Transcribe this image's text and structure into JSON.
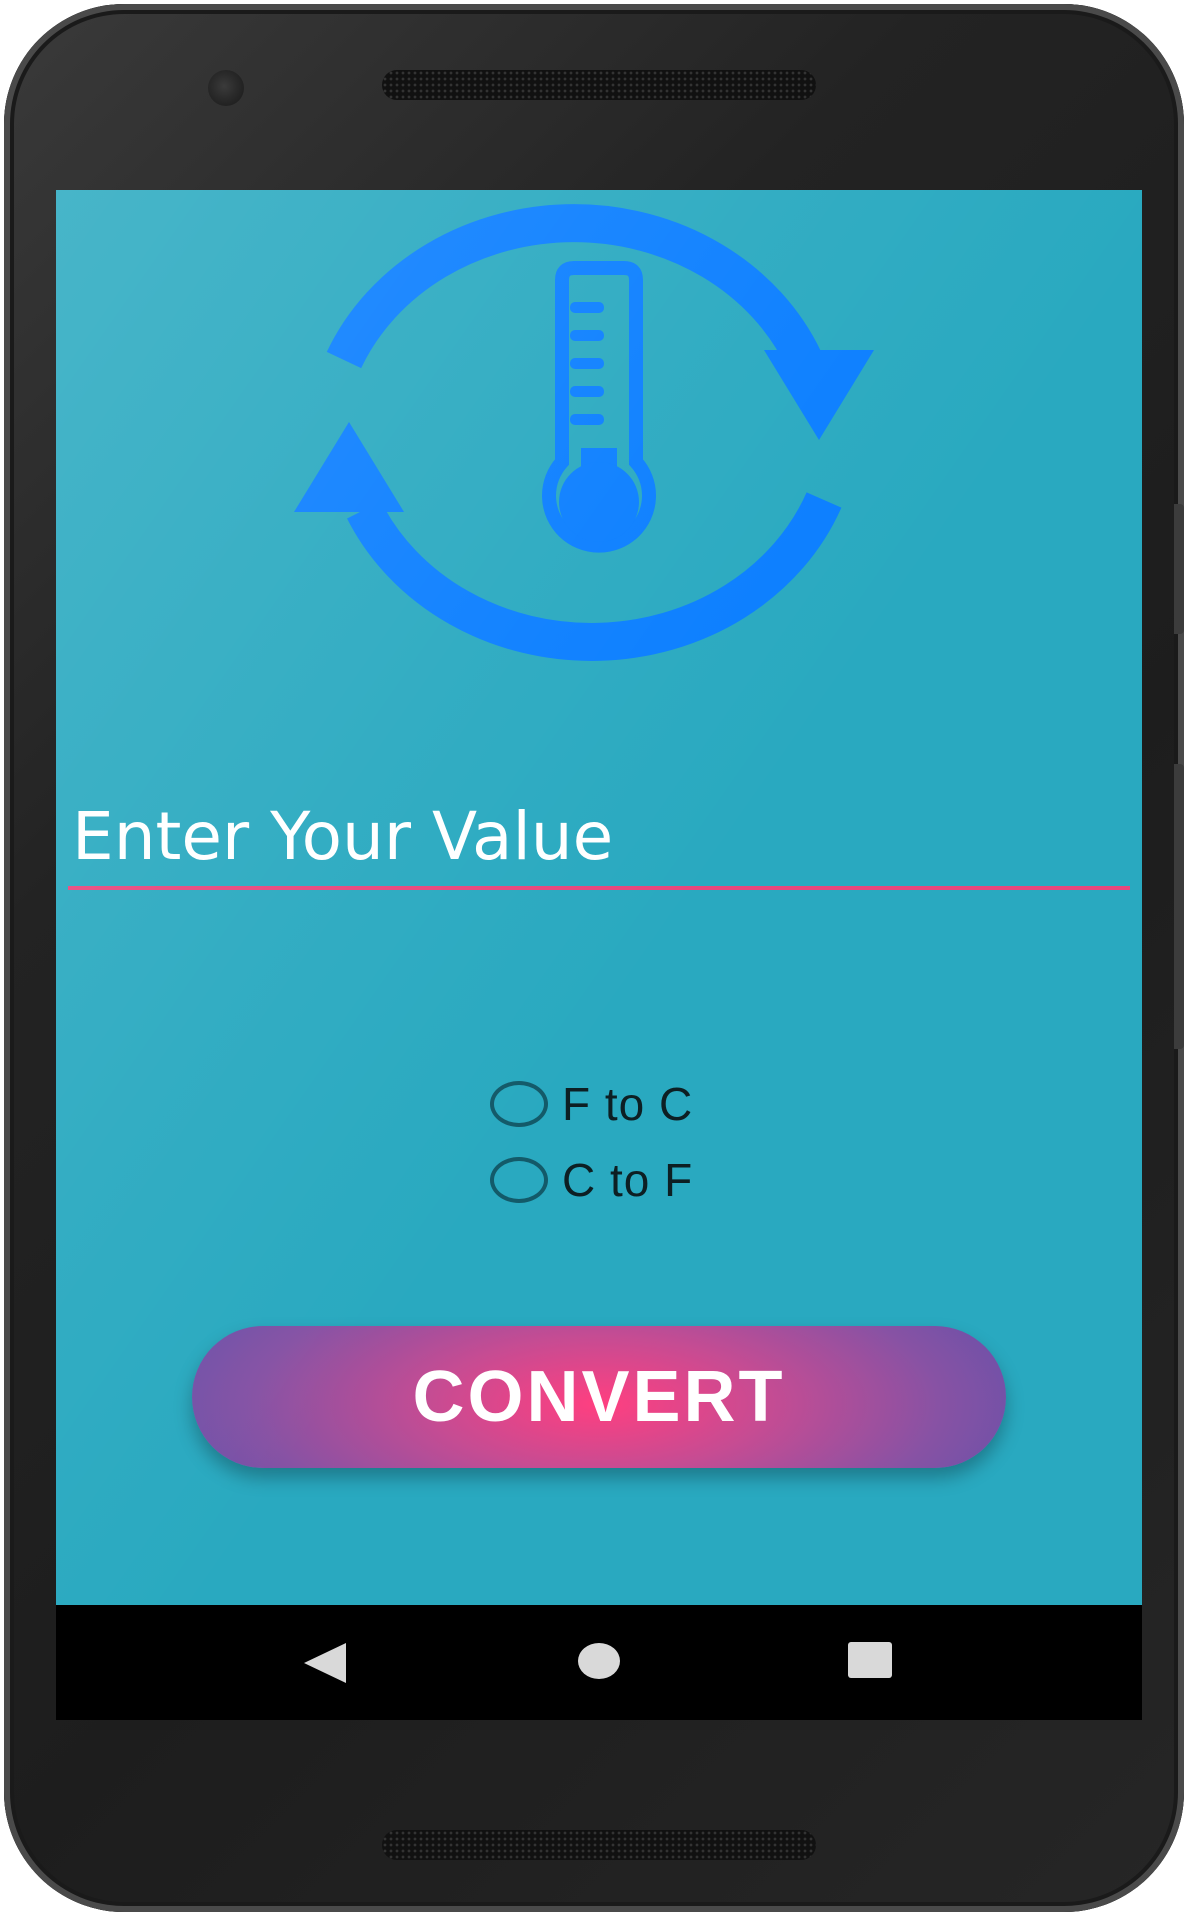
{
  "app": {
    "logo_icon": "thermometer-refresh-icon",
    "accent_color": "#0a7eff",
    "background_color": "#29a9c0"
  },
  "input": {
    "placeholder": "Enter Your Value",
    "value": "",
    "underline_color": "#e8467c"
  },
  "options": [
    {
      "label": "F to C",
      "checked": false
    },
    {
      "label": "C to F",
      "checked": false
    }
  ],
  "convert_button": {
    "label": "CONVERT",
    "gradient_center": "#ff3f80",
    "gradient_edge": "#4a4fae"
  },
  "navigation": {
    "back_icon": "back-triangle-icon",
    "home_icon": "home-circle-icon",
    "recents_icon": "recents-square-icon"
  }
}
